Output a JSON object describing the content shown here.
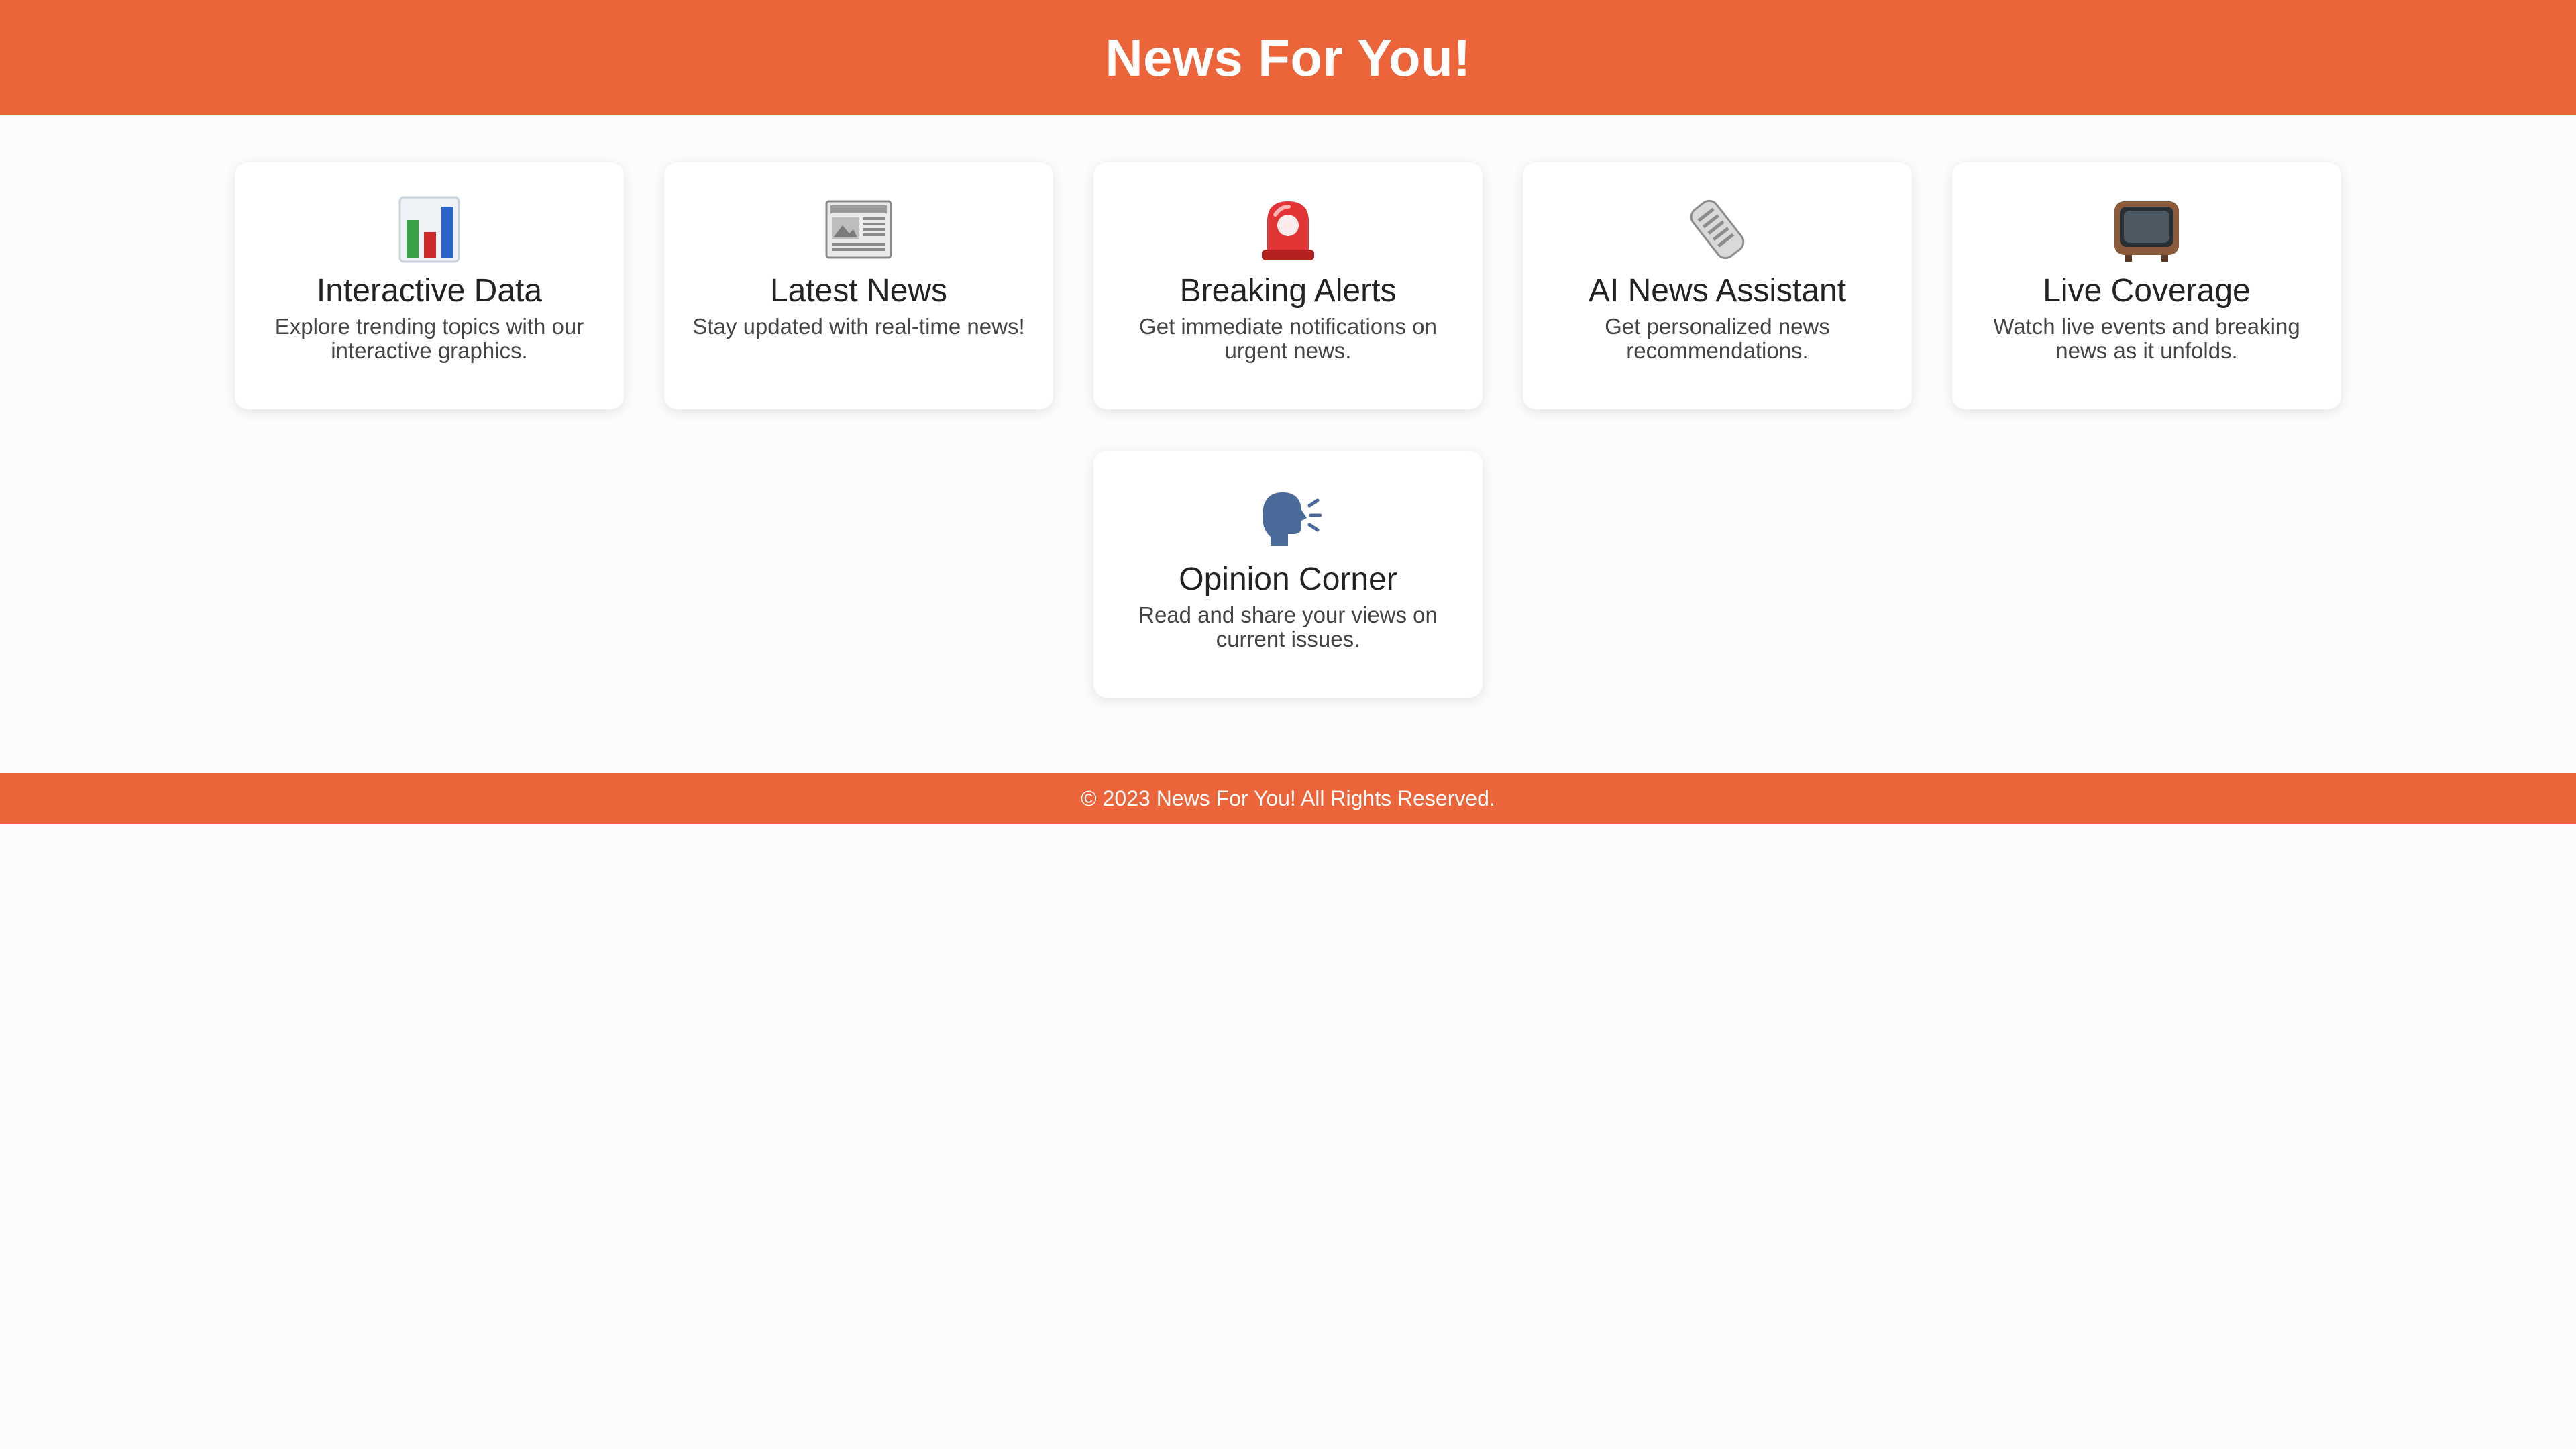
{
  "header": {
    "title": "News For You!"
  },
  "cards": [
    {
      "icon": "bar-chart-icon",
      "title": "Interactive Data",
      "description": "Explore trending topics with our interactive graphics."
    },
    {
      "icon": "newspaper-icon",
      "title": "Latest News",
      "description": "Stay updated with real-time news!"
    },
    {
      "icon": "siren-icon",
      "title": "Breaking Alerts",
      "description": "Get immediate notifications on urgent news."
    },
    {
      "icon": "rolled-newspaper-icon",
      "title": "AI News Assistant",
      "description": "Get personalized news recommendations."
    },
    {
      "icon": "television-icon",
      "title": "Live Coverage",
      "description": "Watch live events and breaking news as it unfolds."
    },
    {
      "icon": "speaking-head-icon",
      "title": "Opinion Corner",
      "description": "Read and share your views on current issues."
    }
  ],
  "footer": {
    "text": "© 2023 News For You! All Rights Reserved."
  },
  "colors": {
    "brand": "#ec6439",
    "background": "#fcfcfc",
    "card": "#ffffff"
  }
}
